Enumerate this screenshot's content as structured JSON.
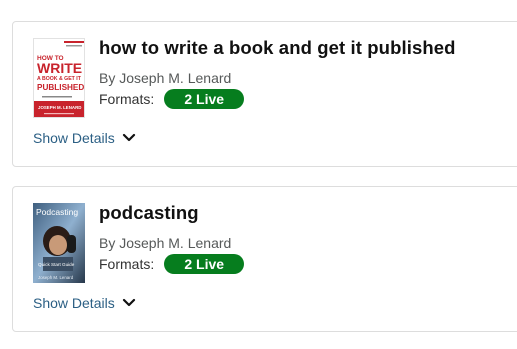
{
  "books": [
    {
      "title": "how to write a book and get it published",
      "author_prefix": "By",
      "author": "Joseph M. Lenard",
      "formats_label": "Formats:",
      "formats_badge": "2 Live",
      "details_label": "Show Details",
      "cover": {
        "line1": "HOW TO",
        "line2": "WRITE",
        "line3": "A BOOK & GET IT",
        "line4": "PUBLISHED",
        "author": "JOSEPH M. LENARD"
      }
    },
    {
      "title": "podcasting",
      "author_prefix": "By",
      "author": "Joseph M. Lenard",
      "formats_label": "Formats:",
      "formats_badge": "2 Live",
      "details_label": "Show Details",
      "cover": {
        "title": "Podcasting",
        "subtitle": "Quick Start Guide",
        "author": "Joseph M. Lenard"
      }
    }
  ],
  "colors": {
    "badge": "#067d1e",
    "link": "#2b5f84",
    "cover_red": "#c8232c"
  }
}
